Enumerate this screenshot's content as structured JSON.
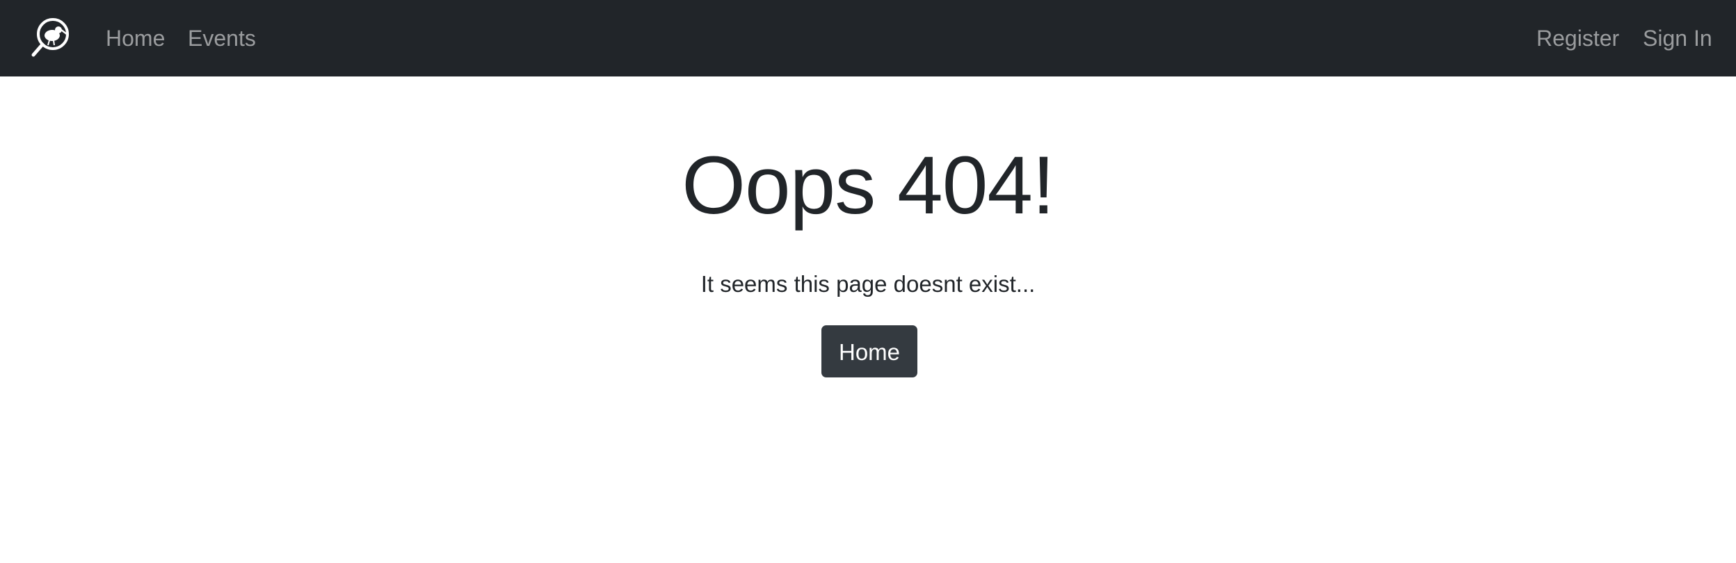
{
  "navbar": {
    "logo_icon": "kiwi-magnifier-logo-icon",
    "links_left": {
      "home": "Home",
      "events": "Events"
    },
    "links_right": {
      "register": "Register",
      "sign_in": "Sign In"
    },
    "background_color": "#212529",
    "link_color": "rgba(255,255,255,0.55)"
  },
  "error_page": {
    "title": "Oops 404!",
    "message": "It seems this page doesnt exist...",
    "home_button_label": "Home",
    "button_color": "#343a40"
  }
}
